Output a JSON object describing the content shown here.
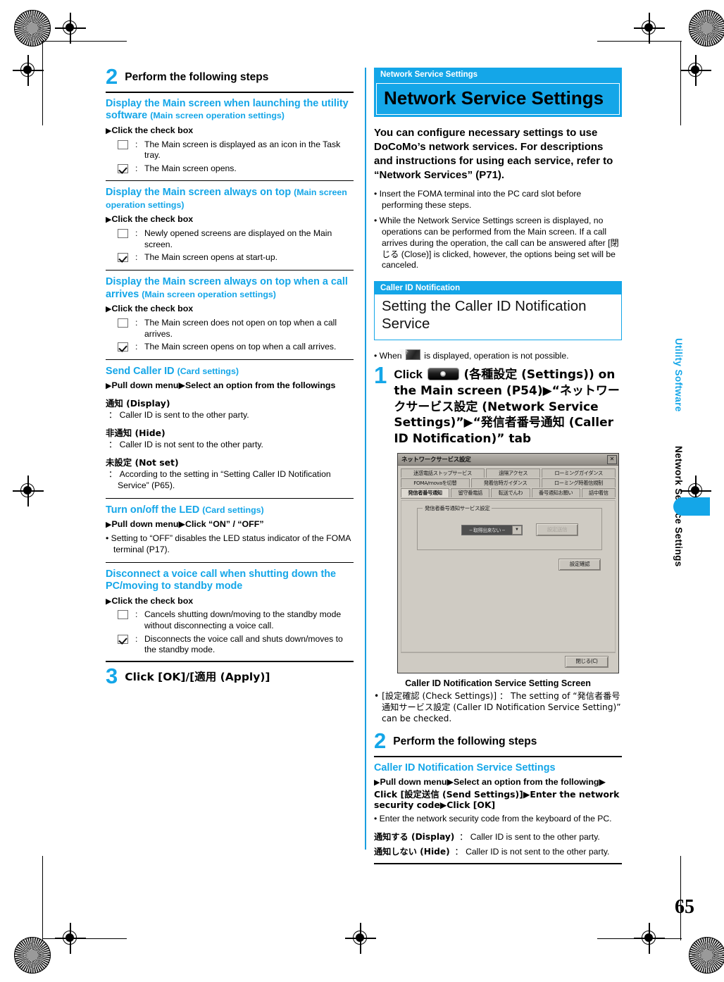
{
  "page": {
    "number": "65",
    "side_tab_top": "Utility Software",
    "side_tab_bottom": "Network Service Settings"
  },
  "left_column": {
    "step2": {
      "num": "2",
      "text": "Perform the following steps"
    },
    "sections": [
      {
        "heading": "Display the Main screen when launching the utility software",
        "heading_sub": "(Main screen operation settings)",
        "action": "Click the check box",
        "checkboxes": [
          {
            "checked": false,
            "text": "The Main screen is displayed as an icon in the Task tray."
          },
          {
            "checked": true,
            "text": "The Main screen opens."
          }
        ]
      },
      {
        "heading": "Display the Main screen always on top",
        "heading_sub": "(Main screen operation settings)",
        "action": "Click the check box",
        "checkboxes": [
          {
            "checked": false,
            "text": "Newly opened screens are displayed on the Main screen."
          },
          {
            "checked": true,
            "text": "The Main screen opens at start-up."
          }
        ]
      },
      {
        "heading": "Display the Main screen always on top when a call arrives",
        "heading_sub": "(Main screen operation settings)",
        "action": "Click the check box",
        "checkboxes": [
          {
            "checked": false,
            "text": "The Main screen does not open on top when a call arrives."
          },
          {
            "checked": true,
            "text": "The Main screen opens on top when a call arrives."
          }
        ]
      }
    ],
    "send_caller_id": {
      "heading": "Send Caller ID",
      "heading_sub": "(Card settings)",
      "action": "Pull down menu▶Select an option from the followings",
      "options": [
        {
          "label": "通知 (Display)",
          "desc": "Caller ID is sent to the other party."
        },
        {
          "label": "非通知 (Hide)",
          "desc": "Caller ID is not sent to the other party."
        },
        {
          "label": "未設定 (Not set)",
          "desc": "According to the setting in “Setting Caller ID Notification Service” (P65)."
        }
      ]
    },
    "led": {
      "heading": "Turn on/off the LED",
      "heading_sub": "(Card settings)",
      "action": "Pull down menu▶Click “ON” / “OFF”",
      "bullet": "Setting to “OFF” disables the LED status indicator of the FOMA terminal (P17)."
    },
    "disconnect": {
      "heading": "Disconnect a voice call when shutting down the PC/moving to standby mode",
      "action": "Click the check box",
      "checkboxes": [
        {
          "checked": false,
          "text": "Cancels shutting down/moving to the standby mode without disconnecting a voice call."
        },
        {
          "checked": true,
          "text": "Disconnects the voice call and shuts down/moves to the standby mode."
        }
      ]
    },
    "step3": {
      "num": "3",
      "text": "Click [OK]/[適用 (Apply)]"
    }
  },
  "right_column": {
    "title_block": {
      "eyebrow": "Network Service Settings",
      "title": "Network Service Settings"
    },
    "lead": "You can configure necessary settings to use DoCoMo’s network services. For descriptions and instructions for using each service, refer to “Network Services” (P71).",
    "bullets": [
      "Insert the FOMA terminal into the PC card slot before performing these steps.",
      "While the Network Service Settings screen is displayed, no operations can be performed from the Main screen. If a call arrives during the operation, the call can be answered after [閉じる (Close)] is clicked, however, the options being set will be canceled."
    ],
    "subtitle_block": {
      "eyebrow": "Caller ID Notification",
      "title": "Setting the Caller ID Notification Service"
    },
    "note_icon_line_before": "When",
    "note_icon_line_after": "is displayed, operation is not possible.",
    "step1": {
      "num": "1",
      "text_a": "Click",
      "text_b": "(各種設定 (Settings)) on the Main screen (P54)▶“ネットワークサービス設定 (Network Service Settings)”▶“発信者番号通知 (Caller ID Notification)” tab"
    },
    "screenshot": {
      "window_title": "ネットワークサービス設定",
      "close_glyph": "✕",
      "tab_rows": [
        [
          "迷惑電話ストップサービス",
          "遠隔アクセス",
          "ローミングガイダンス"
        ],
        [
          "FOMA/movaを切替",
          "発着信時ガイダンス",
          "ローミング時着信規制"
        ],
        [
          "発信者番号通知",
          "留守番電話",
          "転送でんわ",
          "番号通知お願い",
          "話中着信"
        ]
      ],
      "active_tab": "発信者番号通知",
      "group_label": "発信者番号通知サービス設定",
      "combo_value": "-- 取得出来ない --",
      "combo_arrow": "▼",
      "send_button": "設定送信",
      "check_button": "設定確認",
      "close_button": "閉じる(C)"
    },
    "caption": "Caller ID Notification Service Setting Screen",
    "caption_bullet": "[設定確認 (Check Settings)] ： The setting of “発信者番号通知サービス設定 (Caller ID Notification Service Setting)” can be checked.",
    "step2": {
      "num": "2",
      "text": "Perform the following steps"
    },
    "final_section": {
      "heading": "Caller ID Notification Service Settings",
      "action_line1": "Pull down menu▶Select an option from the following▶",
      "action_line2": "Click [設定送信 (Send Settings)]▶Enter the network security code▶Click [OK]",
      "bullet": "Enter the network security code from the keyboard of the PC.",
      "options": [
        {
          "label": "通知する (Display)",
          "desc": "Caller ID is sent to the other party."
        },
        {
          "label": "通知しない (Hide)",
          "desc": "Caller ID is not sent to the other party."
        }
      ]
    }
  },
  "colors": {
    "accent_blue": "#14a6e8",
    "text_black": "#000000"
  }
}
